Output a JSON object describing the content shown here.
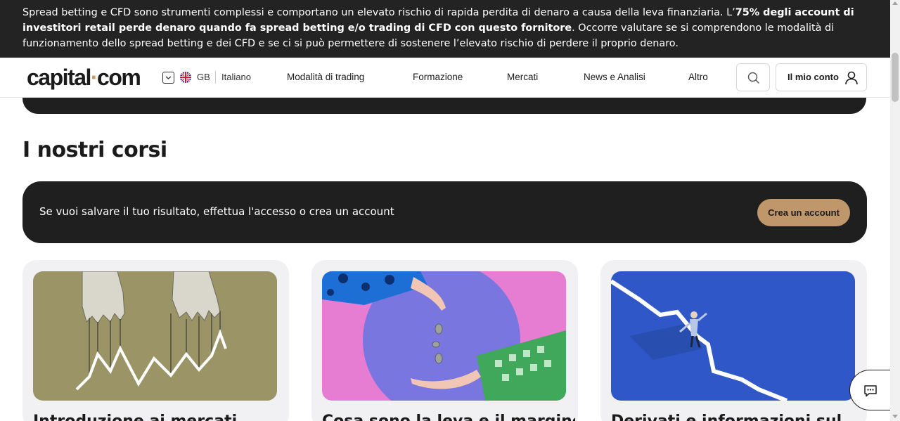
{
  "risk_warning": {
    "text_before": "Spread betting e CFD sono strumenti complessi e comportano un elevato rischio di rapida perdita di denaro a causa della leva finanziaria. L’",
    "text_bold": "75% degli account di investitori retail perde denaro quando fa spread betting e/o trading di CFD con questo fornitore",
    "text_after": ". Occorre valutare se si comprendono le modalità di funzionamento dello spread betting e dei CFD e se ci si può permettere di sostenere l’elevato rischio di perdere il proprio denaro."
  },
  "header": {
    "logo_left": "capital",
    "logo_dot": "·",
    "logo_right": "com",
    "country": "GB",
    "language": "Italiano",
    "nav": [
      {
        "label": "Modalità di trading"
      },
      {
        "label": "Formazione"
      },
      {
        "label": "Mercati"
      },
      {
        "label": "News e Analisi"
      },
      {
        "label": "Altro"
      }
    ],
    "account_label": "Il mio conto",
    "icons": {
      "search": "search-icon",
      "account": "user-icon",
      "language_toggle": "chevron-down-icon",
      "flag": "uk-flag-icon"
    }
  },
  "main": {
    "section_title": "I nostri corsi",
    "login_banner": {
      "text": "Se vuoi salvare il tuo risultato, effettua l'accesso o crea un account",
      "button_label": "Crea un account"
    },
    "courses": [
      {
        "title": "Introduzione ai mercati"
      },
      {
        "title": "Cosa sono la leva e il margine?"
      },
      {
        "title": "Derivati e informazioni sul"
      }
    ]
  },
  "colors": {
    "banner_bg": "#232323",
    "accent": "#c0966b",
    "card_bg": "#f1f1f3",
    "text": "#1b1b1b"
  },
  "chat": {
    "icon": "chat-icon"
  }
}
